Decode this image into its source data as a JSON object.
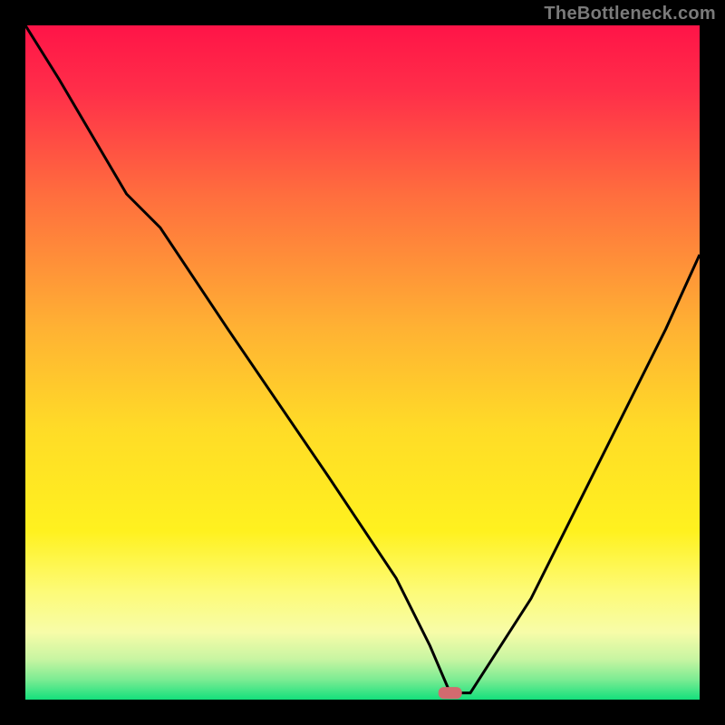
{
  "watermark": "TheBottleneck.com",
  "chart_data": {
    "type": "line",
    "title": "",
    "xlabel": "",
    "ylabel": "",
    "xlim": [
      0,
      100
    ],
    "ylim": [
      0,
      100
    ],
    "grid": false,
    "legend": false,
    "background_gradient": {
      "top_color": "#ff1a4d",
      "mid_color": "#ffe423",
      "bottom_color": "#14e07c"
    },
    "series": [
      {
        "name": "bottleneck-curve",
        "x": [
          0,
          5,
          15,
          20,
          30,
          45,
          55,
          60,
          63,
          66,
          75,
          85,
          95,
          100
        ],
        "y": [
          100,
          92,
          75,
          70,
          55,
          33,
          18,
          8,
          1,
          1,
          15,
          35,
          55,
          66
        ]
      }
    ],
    "marker": {
      "name": "optimal-point",
      "x": 63,
      "y": 1,
      "color": "#d26a6f"
    }
  }
}
